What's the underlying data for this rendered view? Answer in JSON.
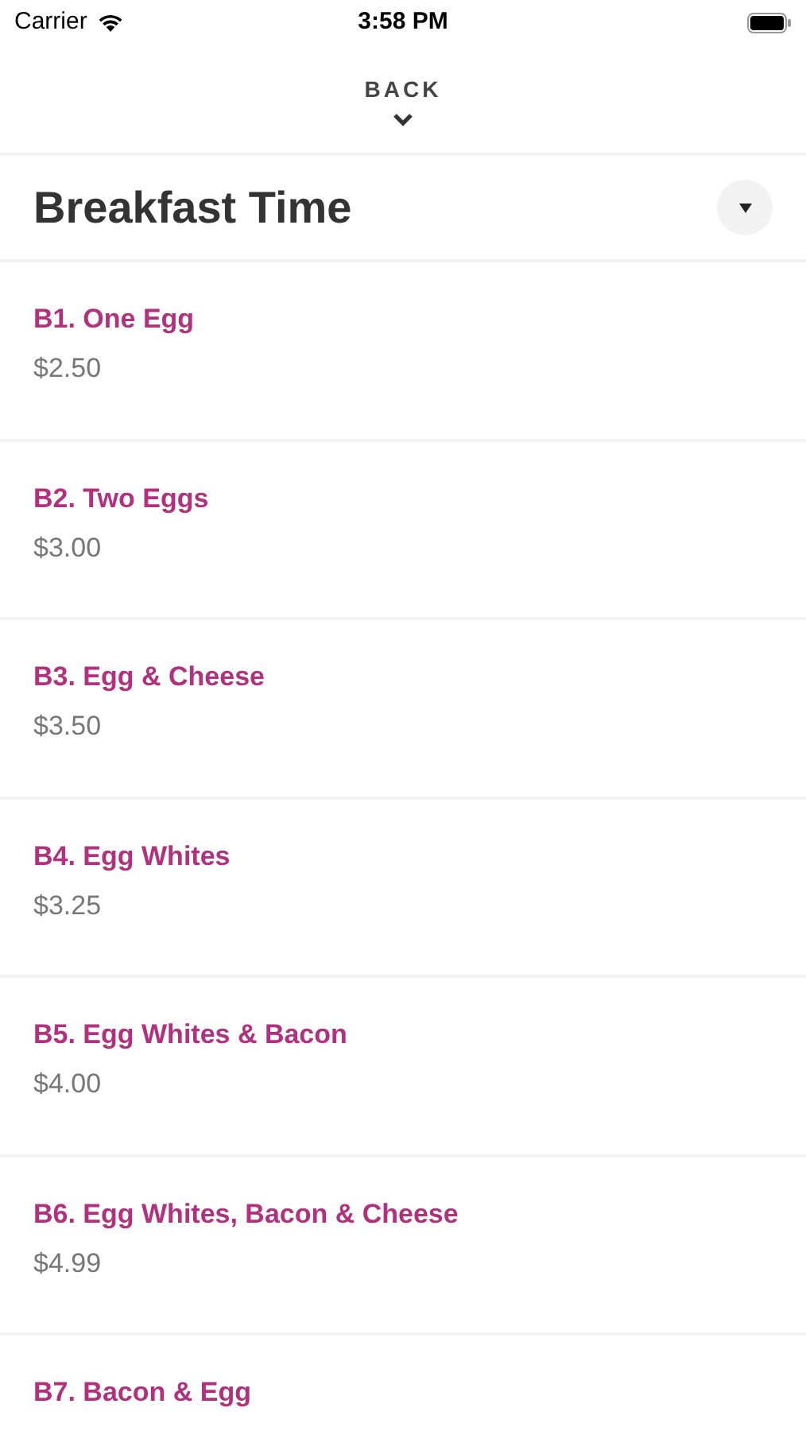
{
  "status_bar": {
    "carrier": "Carrier",
    "time": "3:58 PM"
  },
  "nav": {
    "back": "BACK"
  },
  "section": {
    "title": "Breakfast Time",
    "expanded": true
  },
  "items": [
    {
      "name": "B1. One Egg",
      "price": "$2.50"
    },
    {
      "name": "B2. Two Eggs",
      "price": "$3.00"
    },
    {
      "name": "B3. Egg & Cheese",
      "price": "$3.50"
    },
    {
      "name": "B4. Egg Whites",
      "price": "$3.25"
    },
    {
      "name": "B5. Egg Whites & Bacon",
      "price": "$4.00"
    },
    {
      "name": "B6. Egg Whites, Bacon & Cheese",
      "price": "$4.99"
    },
    {
      "name": "B7. Bacon & Egg"
    }
  ]
}
